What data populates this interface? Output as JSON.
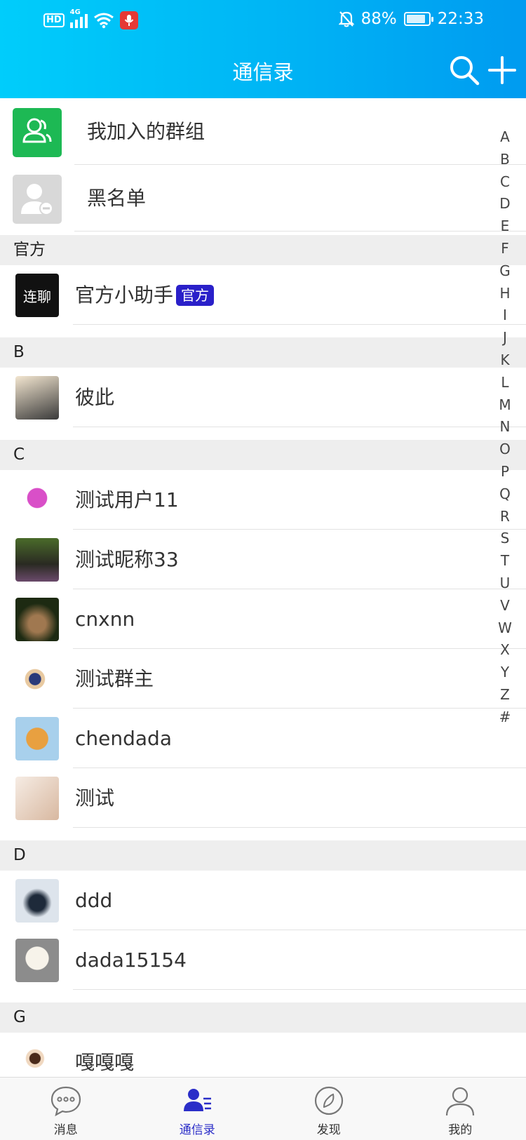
{
  "status": {
    "hd": "HD",
    "network": "4G",
    "battery_percent": "88%",
    "battery_level": 0.88,
    "time": "22:33"
  },
  "header": {
    "title": "通信录"
  },
  "top_items": [
    {
      "label": "我加入的群组",
      "icon": "group-icon",
      "color": "#1db954"
    },
    {
      "label": "黑名单",
      "icon": "blocked-user-icon",
      "color": "#d8d8d8"
    }
  ],
  "sections": [
    {
      "title": "官方",
      "contacts": [
        {
          "name": "官方小助手",
          "badge": "官方",
          "avatar_text": "连聊"
        }
      ]
    },
    {
      "title": "B",
      "contacts": [
        {
          "name": "彼此"
        }
      ]
    },
    {
      "title": "C",
      "contacts": [
        {
          "name": "测试用户11"
        },
        {
          "name": "测试昵称33"
        },
        {
          "name": "cnxnn"
        },
        {
          "name": "测试群主"
        },
        {
          "name": "chendada"
        },
        {
          "name": "测试"
        }
      ]
    },
    {
      "title": "D",
      "contacts": [
        {
          "name": "ddd"
        },
        {
          "name": "dada15154"
        }
      ]
    },
    {
      "title": "G",
      "contacts": [
        {
          "name": "嘎嘎嘎"
        }
      ]
    }
  ],
  "index_letters": [
    "A",
    "B",
    "C",
    "D",
    "E",
    "F",
    "G",
    "H",
    "I",
    "J",
    "K",
    "L",
    "M",
    "N",
    "O",
    "P",
    "Q",
    "R",
    "S",
    "T",
    "U",
    "V",
    "W",
    "X",
    "Y",
    "Z",
    "#"
  ],
  "tabs": [
    {
      "label": "消息",
      "icon": "chat-bubble-icon",
      "active": false
    },
    {
      "label": "通信录",
      "icon": "contacts-icon",
      "active": true
    },
    {
      "label": "发现",
      "icon": "compass-icon",
      "active": false
    },
    {
      "label": "我的",
      "icon": "user-profile-icon",
      "active": false
    }
  ],
  "colors": {
    "header_start": "#00cdfb",
    "header_end": "#009bf0",
    "accent": "#2b2ec8",
    "badge": "#2a20c9"
  }
}
